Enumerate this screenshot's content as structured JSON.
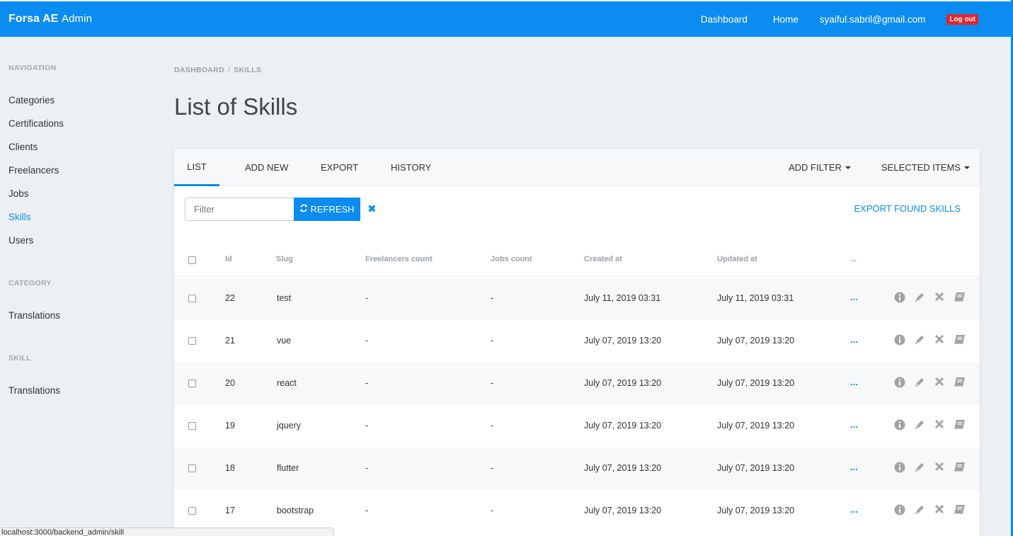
{
  "header": {
    "brand": "Forsa AE",
    "brand_sub": "Admin",
    "nav": {
      "dashboard": "Dashboard",
      "home": "Home",
      "user": "syaiful.sabril@gmail.com",
      "logout": "Log out"
    }
  },
  "sidebar": {
    "nav_heading": "NAVIGATION",
    "nav_items": [
      "Categories",
      "Certifications",
      "Clients",
      "Freelancers",
      "Jobs",
      "Skills",
      "Users"
    ],
    "active_item": "Skills",
    "category_heading": "CATEGORY",
    "category_item": "Translations",
    "skill_heading": "SKILL",
    "skill_item": "Translations"
  },
  "breadcrumb": {
    "root": "DASHBOARD",
    "separator": "/",
    "current": "SKILLS"
  },
  "page": {
    "title": "List of Skills"
  },
  "tabs": {
    "list": "LIST",
    "add_new": "ADD NEW",
    "export": "EXPORT",
    "history": "HISTORY",
    "add_filter": "ADD FILTER",
    "selected_items": "SELECTED ITEMS"
  },
  "filter": {
    "placeholder": "Filter",
    "refresh": "REFRESH",
    "export_found": "EXPORT FOUND SKILLS"
  },
  "table": {
    "columns": [
      "Id",
      "Slug",
      "Freelancers count",
      "Jobs count",
      "Created at",
      "Updated at",
      "..."
    ],
    "rows": [
      {
        "id": "22",
        "slug": "test",
        "freelancers": "-",
        "jobs": "-",
        "created": "July 11, 2019 03:31",
        "updated": "July 11, 2019 03:31",
        "more": "..."
      },
      {
        "id": "21",
        "slug": "vue",
        "freelancers": "-",
        "jobs": "-",
        "created": "July 07, 2019 13:20",
        "updated": "July 07, 2019 13:20",
        "more": "..."
      },
      {
        "id": "20",
        "slug": "react",
        "freelancers": "-",
        "jobs": "-",
        "created": "July 07, 2019 13:20",
        "updated": "July 07, 2019 13:20",
        "more": "..."
      },
      {
        "id": "19",
        "slug": "jquery",
        "freelancers": "-",
        "jobs": "-",
        "created": "July 07, 2019 13:20",
        "updated": "July 07, 2019 13:20",
        "more": "..."
      },
      {
        "id": "18",
        "slug": "flutter",
        "freelancers": "-",
        "jobs": "-",
        "created": "July 07, 2019 13:20",
        "updated": "July 07, 2019 13:20",
        "more": "..."
      },
      {
        "id": "17",
        "slug": "bootstrap",
        "freelancers": "-",
        "jobs": "-",
        "created": "July 07, 2019 13:20",
        "updated": "July 07, 2019 13:20",
        "more": "..."
      }
    ]
  },
  "status_bar": {
    "url": "localhost:3000/backend_admin/skill"
  },
  "colors": {
    "accent": "#0a8cf0",
    "logout": "#e0242f",
    "background": "#ecf0f3"
  }
}
